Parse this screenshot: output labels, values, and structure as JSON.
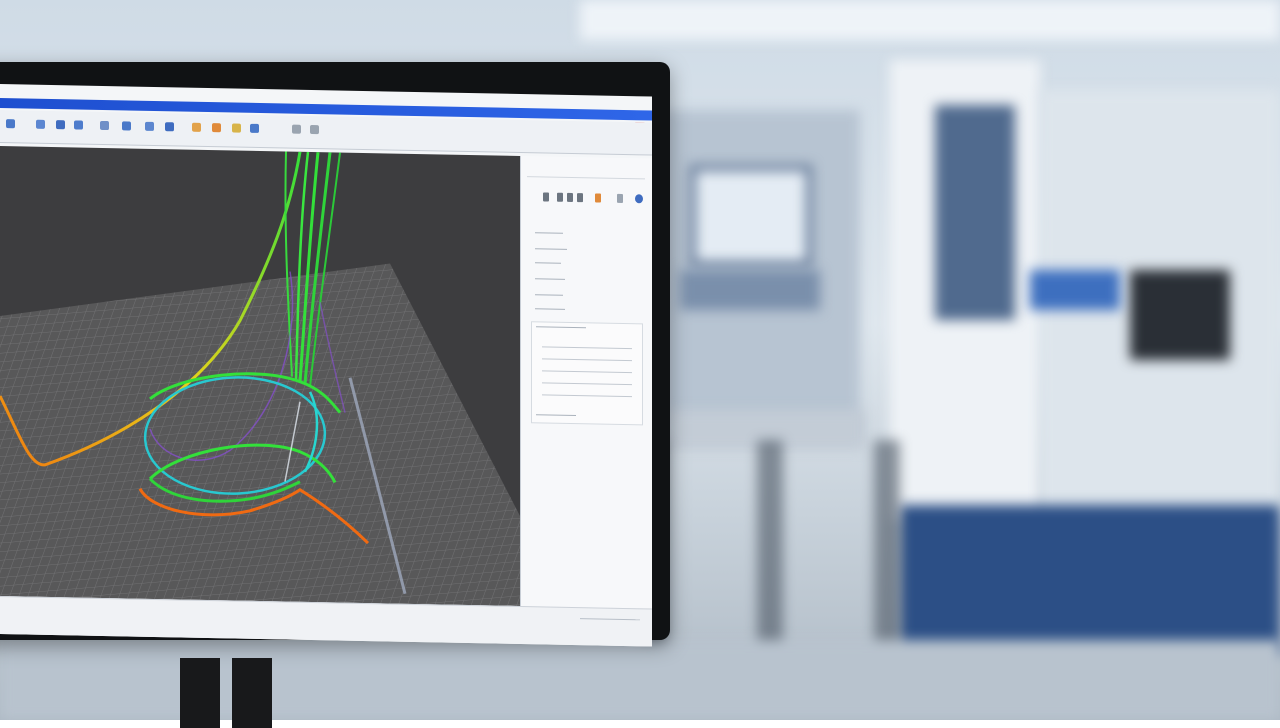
{
  "scene": {
    "description_free": true,
    "colors": {
      "background_floor": "#c9d3dc",
      "monitor_bezel": "#101214",
      "titlebar": "#2f66e8",
      "viewport": "#3d3d3f",
      "grid_plane": "#5a5a5c",
      "toolpath_green": "#33e03a",
      "toolpath_orange": "#f06a12",
      "toolpath_cyan": "#28d6d0",
      "toolpath_purple": "#8a4fd8",
      "toolpath_yellow": "#e6d21a"
    }
  },
  "app": {
    "title": "",
    "toolbar_icons": [
      "file-icon",
      "open-icon",
      "save-icon",
      "zoom-icon",
      "rotate-icon",
      "pan-icon",
      "view-icon",
      "settings-icon",
      "play-icon",
      "stop-icon",
      "measure-icon",
      "help-icon"
    ],
    "close_icon": "close-icon"
  },
  "panel": {
    "title": "",
    "icons": [
      "tool-icon",
      "spindle-icon",
      "axis-icon",
      "feed-icon",
      "warning-icon",
      "info-icon",
      "globe-icon"
    ]
  }
}
